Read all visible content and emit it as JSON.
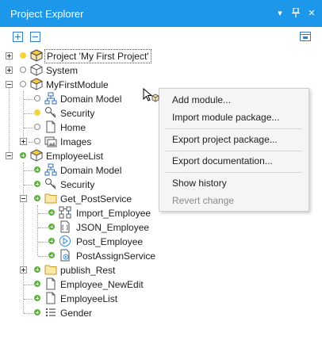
{
  "panel": {
    "title": "Project Explorer",
    "dropdown_icon": "▾",
    "pin_icon": "▪",
    "close_icon": "✕"
  },
  "toolbar": {
    "expand_all": "expand-all",
    "collapse_all": "collapse-all",
    "sync": "sync-with-editor"
  },
  "tree": [
    {
      "label": "Project 'My First Project'",
      "icon": "project-icon",
      "status": "yellow",
      "expander": "plus"
    },
    {
      "label": "System",
      "icon": "module-icon",
      "status": "hollow",
      "expander": "plus"
    },
    {
      "label": "MyFirstModule",
      "icon": "module-icon",
      "status": "hollow",
      "expander": "minus"
    },
    {
      "label": "Domain Model",
      "icon": "domain-model-icon",
      "status": "hollow"
    },
    {
      "label": "Security",
      "icon": "key-icon",
      "status": "yellow"
    },
    {
      "label": "Home",
      "icon": "page-icon",
      "status": "hollow"
    },
    {
      "label": "Images",
      "icon": "images-icon",
      "status": "hollow",
      "expander": "plus"
    },
    {
      "label": "EmployeeList",
      "icon": "module-icon",
      "status": "green",
      "expander": "minus"
    },
    {
      "label": "Domain Model",
      "icon": "domain-model-icon",
      "status": "green"
    },
    {
      "label": "Security",
      "icon": "key-icon",
      "status": "green"
    },
    {
      "label": "Get_PostService",
      "icon": "folder-icon",
      "status": "green",
      "expander": "minus"
    },
    {
      "label": "Import_Employee",
      "icon": "import-mapping-icon",
      "status": "green"
    },
    {
      "label": "JSON_Employee",
      "icon": "json-icon",
      "status": "green"
    },
    {
      "label": "Post_Employee",
      "icon": "microflow-icon",
      "status": "green"
    },
    {
      "label": "PostAssignService",
      "icon": "service-icon",
      "status": "green"
    },
    {
      "label": "publish_Rest",
      "icon": "folder-icon",
      "status": "green",
      "expander": "plus"
    },
    {
      "label": "Employee_NewEdit",
      "icon": "page-icon",
      "status": "green"
    },
    {
      "label": "EmployeeList",
      "icon": "page-icon",
      "status": "green"
    },
    {
      "label": "Gender",
      "icon": "enumeration-icon",
      "status": "green"
    }
  ],
  "context_menu": {
    "add_module": "Add module...",
    "import_module": "Import module package...",
    "export_project": "Export project package...",
    "export_docs": "Export documentation...",
    "show_history": "Show history",
    "revert_change": "Revert change"
  },
  "colors": {
    "titlebar": "#1c97ea",
    "status_yellow": "#f5d33b",
    "status_green": "#5bb53a"
  }
}
